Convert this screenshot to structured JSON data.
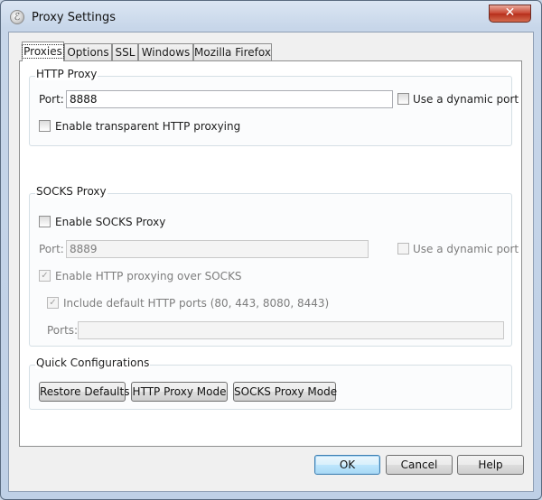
{
  "window": {
    "title": "Proxy Settings",
    "close_glyph": "✕",
    "app_icon": "fiddler-app-icon",
    "app_icon_glyph": "ℰ"
  },
  "tabs": [
    {
      "label": "Proxies",
      "active": true
    },
    {
      "label": "Options"
    },
    {
      "label": "SSL"
    },
    {
      "label": "Windows"
    },
    {
      "label": "Mozilla Firefox"
    }
  ],
  "http_proxy": {
    "group_title": "HTTP Proxy",
    "port_label": "Port:",
    "port_value": "8888",
    "dynamic_port_label": "Use a dynamic port",
    "dynamic_port_checked": false,
    "transparent_label": "Enable transparent HTTP proxying",
    "transparent_checked": false
  },
  "socks_proxy": {
    "group_title": "SOCKS Proxy",
    "enable_label": "Enable SOCKS Proxy",
    "enable_checked": false,
    "port_label": "Port:",
    "port_value": "8889",
    "dynamic_port_label": "Use a dynamic port",
    "http_over_socks_label": "Enable HTTP proxying over SOCKS",
    "http_over_socks_checked": true,
    "include_default_ports_label": "Include default HTTP ports (80, 443, 8080, 8443)",
    "include_default_ports_checked": true,
    "ports_label": "Ports:",
    "ports_value": ""
  },
  "quick_config": {
    "group_title": "Quick Configurations",
    "restore_defaults": "Restore Defaults",
    "http_proxy_mode": "HTTP Proxy Mode",
    "socks_proxy_mode": "SOCKS Proxy Mode"
  },
  "footer": {
    "ok": "OK",
    "cancel": "Cancel",
    "help": "Help"
  },
  "check_glyph": "✓"
}
